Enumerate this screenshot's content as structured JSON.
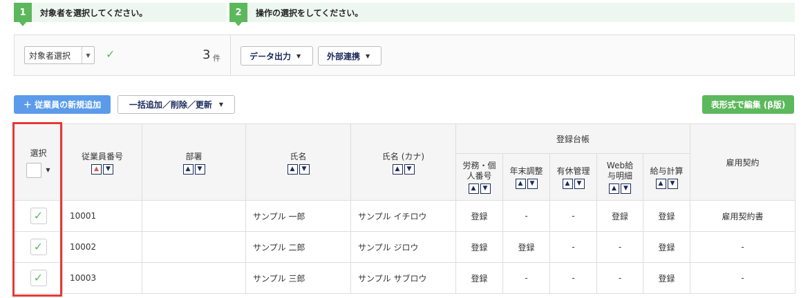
{
  "steps": [
    {
      "num": "1",
      "label": "対象者を選択してください。"
    },
    {
      "num": "2",
      "label": "操作の選択をしてください。"
    }
  ],
  "selection": {
    "select_value": "対象者選択",
    "count": "3",
    "count_unit": "件",
    "data_export": "データ出力",
    "external_link": "外部連携"
  },
  "actions": {
    "add_employee": "＋ 従業員の新規追加",
    "bulk": "一括追加／削除／更新",
    "table_edit": "表形式で編集 (β版)"
  },
  "table": {
    "headers": {
      "select": "選択",
      "employee_no": "従業員番号",
      "department": "部署",
      "name": "氏名",
      "name_kana": "氏名 (カナ)",
      "ledger": "登録台帳",
      "labor": "労務・個人番号",
      "year_end": "年末調整",
      "paid_leave": "有休管理",
      "web_payslip": "Web給与明細",
      "payroll": "給与計算",
      "contract": "雇用契約"
    },
    "rows": [
      {
        "no": "10001",
        "dept": "",
        "name": "サンプル 一郎",
        "kana": "サンプル イチロウ",
        "labor": "登録",
        "year_end": "-",
        "leave": "-",
        "web": "登録",
        "payroll": "登録",
        "contract": "雇用契約書"
      },
      {
        "no": "10002",
        "dept": "",
        "name": "サンプル 二郎",
        "kana": "サンプル ジロウ",
        "labor": "登録",
        "year_end": "登録",
        "leave": "-",
        "web": "-",
        "payroll": "登録",
        "contract": "-"
      },
      {
        "no": "10003",
        "dept": "",
        "name": "サンプル 三郎",
        "kana": "サンプル サブロウ",
        "labor": "登録",
        "year_end": "-",
        "leave": "-",
        "web": "-",
        "payroll": "登録",
        "contract": "-"
      }
    ]
  },
  "colors": {
    "accent_green": "#5cb85c",
    "accent_blue": "#5b9bea",
    "highlight_red": "#e53935"
  }
}
